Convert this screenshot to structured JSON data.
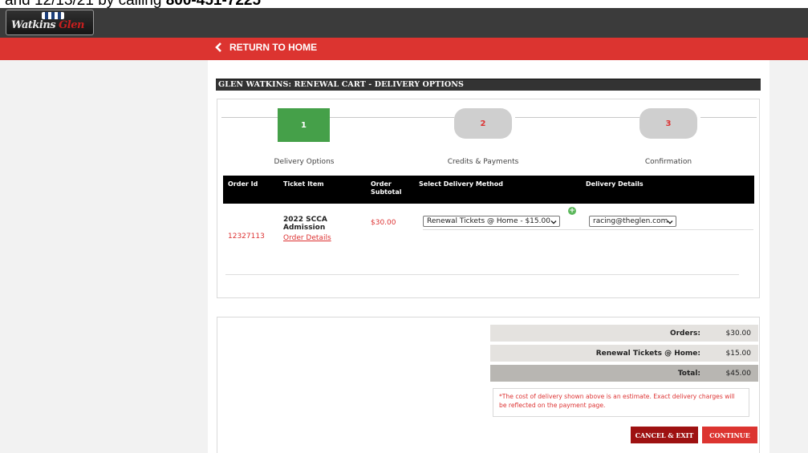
{
  "top_banner": {
    "text_start": "and 12/13/21 by calling ",
    "text_bold": "800-451-7225"
  },
  "logo": {
    "text_a": "Watkins",
    "text_b": "Glen"
  },
  "nav": {
    "return_label": "RETURN TO HOME"
  },
  "page_title": "GLEN WATKINS: RENEWAL CART - DELIVERY OPTIONS",
  "steps": [
    {
      "number": "1",
      "label": "Delivery Options"
    },
    {
      "number": "2",
      "label": "Credits & Payments"
    },
    {
      "number": "3",
      "label": "Confirmation"
    }
  ],
  "table": {
    "headers": {
      "order_id": "Order Id",
      "ticket_item": "Ticket Item",
      "order_subtotal_a": "Order",
      "order_subtotal_b": "Subtotal",
      "delivery_method": "Select Delivery Method",
      "delivery_details": "Delivery Details"
    },
    "row": {
      "order_id": "12327113",
      "ticket_item_a": "2022 SCCA",
      "ticket_item_b": "Admission",
      "order_details_link": "Order Details",
      "subtotal": "$30.00",
      "delivery_method": "Renewal Tickets @ Home - $15.00",
      "delivery_details": "racing@theglen.com"
    }
  },
  "summary": {
    "orders_label": "Orders:",
    "orders_value": "$30.00",
    "delivery_label": "Renewal Tickets @ Home:",
    "delivery_value": "$15.00",
    "total_label": "Total:",
    "total_value": "$45.00"
  },
  "note": "*The cost of delivery shown above is an estimate. Exact delivery charges will be reflected on the payment page.",
  "buttons": {
    "cancel": "CANCEL & EXIT",
    "continue": "CONTINUE"
  },
  "colors": {
    "accent_red": "#dc3430",
    "dark_red": "#9e1111",
    "step_done_green": "#45a049",
    "header_dark": "#333333"
  },
  "icons": {
    "back": "chevron-left-icon",
    "add": "plus-circle-icon",
    "dropdown": "chevron-down-icon"
  }
}
